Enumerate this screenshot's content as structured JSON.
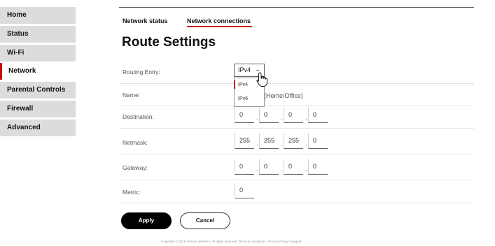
{
  "sidebar": {
    "items": [
      {
        "label": "Home"
      },
      {
        "label": "Status"
      },
      {
        "label": "Wi-Fi"
      },
      {
        "label": "Network"
      },
      {
        "label": "Parental Controls"
      },
      {
        "label": "Firewall"
      },
      {
        "label": "Advanced"
      }
    ],
    "active": "Network"
  },
  "tabs": [
    {
      "label": "Network status"
    },
    {
      "label": "Network connections"
    }
  ],
  "active_tab": "Network connections",
  "page_title": "Route Settings",
  "form": {
    "routing_entry": {
      "label": "Routing Entry:",
      "value": "IPv4",
      "options": [
        "IPv4",
        "IPv6"
      ]
    },
    "name": {
      "label": "Name:",
      "value": "(Home/Office)"
    },
    "destination": {
      "label": "Destination:",
      "octets": [
        "0",
        "0",
        "0",
        "0"
      ]
    },
    "netmask": {
      "label": "Netmask:",
      "octets": [
        "255",
        "255",
        "255",
        "0"
      ]
    },
    "gateway": {
      "label": "Gateway:",
      "octets": [
        "0",
        "0",
        "0",
        "0"
      ]
    },
    "metric": {
      "label": "Metric:",
      "value": "0"
    }
  },
  "buttons": {
    "apply": "Apply",
    "cancel": "Cancel"
  },
  "footer": {
    "text": "Copyright © 2019 Verizon Wireless. All rights reserved. Terms & Conditions | Privacy Policy | Support"
  },
  "colors": {
    "accent": "#cd040b",
    "sidebar_bg": "#dcdcdc",
    "primary_button": "#000000"
  }
}
